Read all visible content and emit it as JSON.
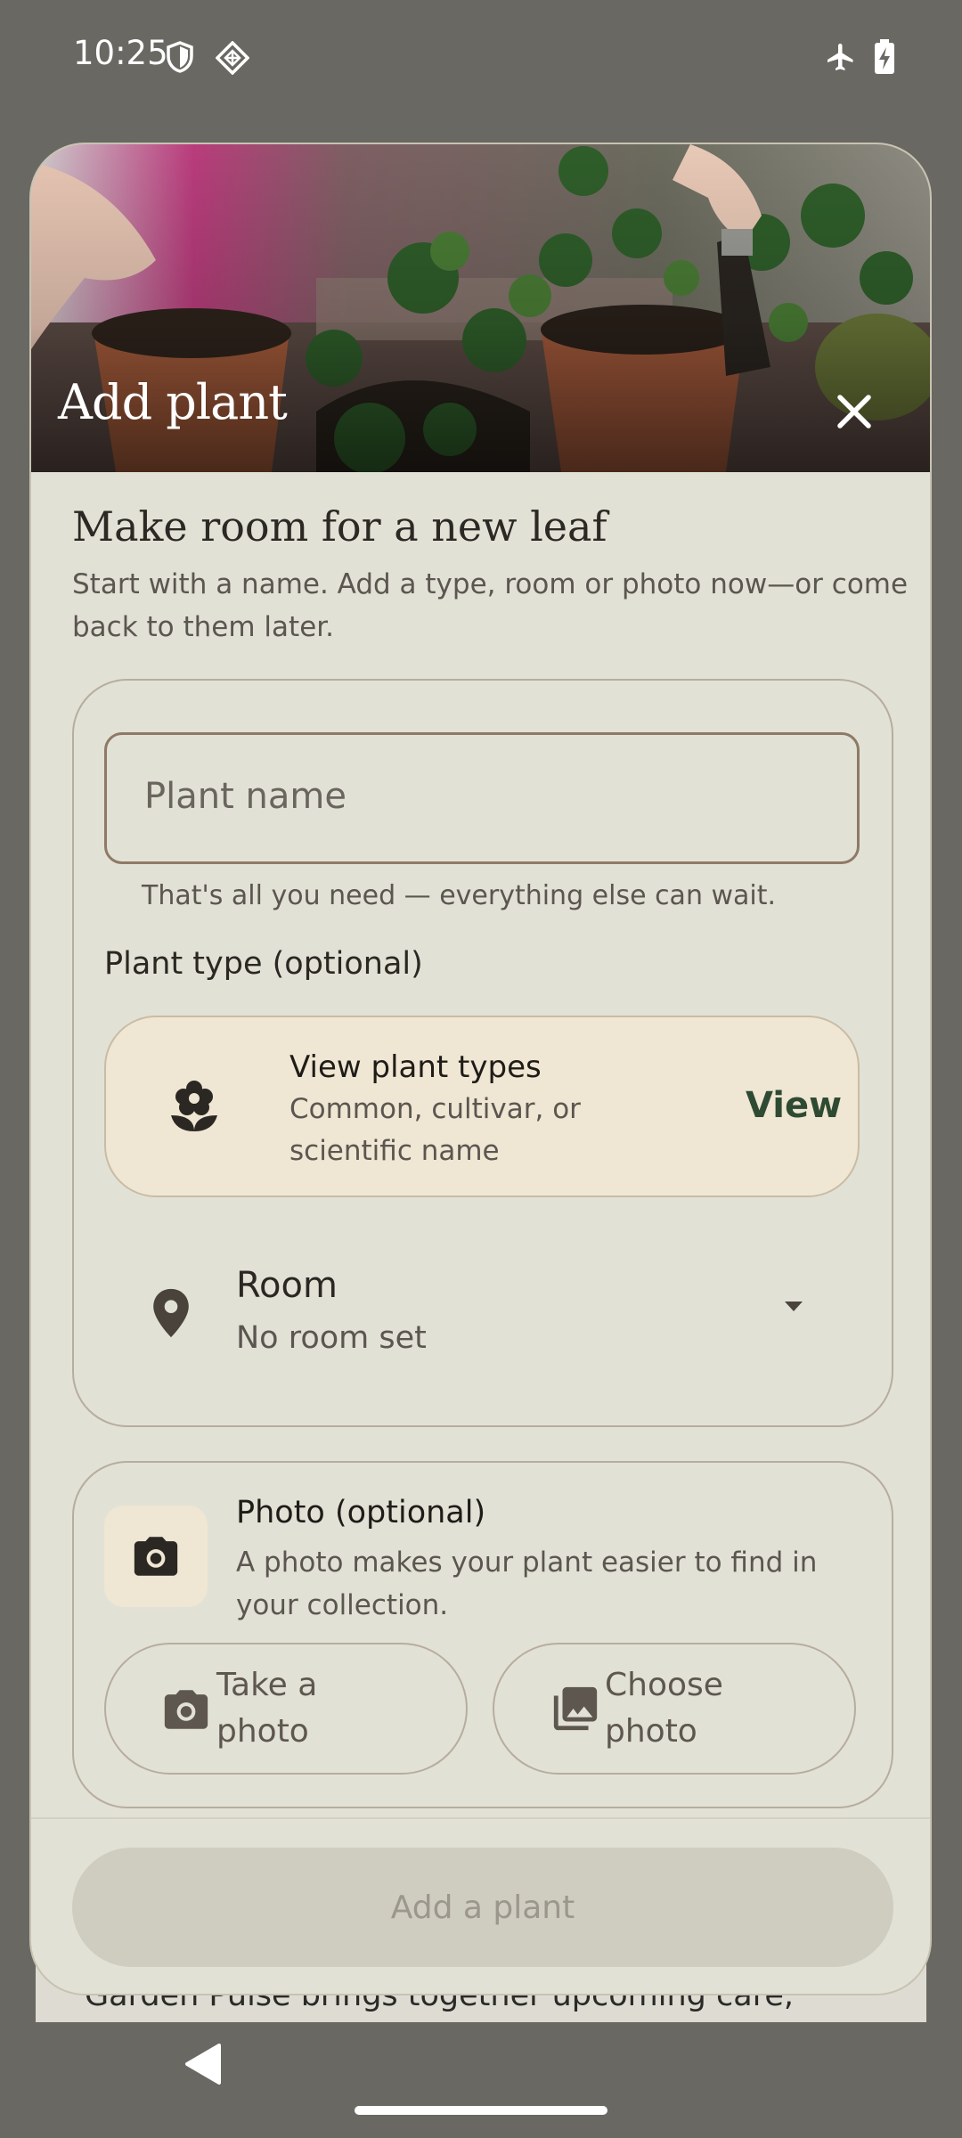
{
  "status_bar": {
    "time": "10:25",
    "left_icons": [
      "shield-icon",
      "diamond-grid-icon"
    ],
    "right_icons": [
      "airplane-icon",
      "battery-charging-icon"
    ]
  },
  "dialog": {
    "title": "Add plant",
    "heading": "Make room for a new leaf",
    "subheading": "Start with a name. Add a type, room or photo now—or come back to them later.",
    "name_field": {
      "placeholder": "Plant name",
      "helper": "That's all you need — everything else can wait."
    },
    "plant_type": {
      "section_label": "Plant type (optional)",
      "card_title": "View plant types",
      "card_subtitle": "Common, cultivar, or scientific name",
      "action": "View"
    },
    "room": {
      "label": "Room",
      "value": "No room set"
    },
    "photo": {
      "title": "Photo (optional)",
      "subtitle": "A photo makes your plant easier to find in your collection.",
      "take_photo": "Take a photo",
      "choose_photo": "Choose photo"
    },
    "primary_button": "Add a plant"
  },
  "background": {
    "partial_text": "Garden Pulse brings together upcoming care,"
  },
  "colors": {
    "scrim": "#696863",
    "dialog_bg": "#e2e1d6",
    "accent_card": "#efe6d3",
    "view_link": "#2f4a32",
    "disabled_button": "#cfccc0"
  }
}
